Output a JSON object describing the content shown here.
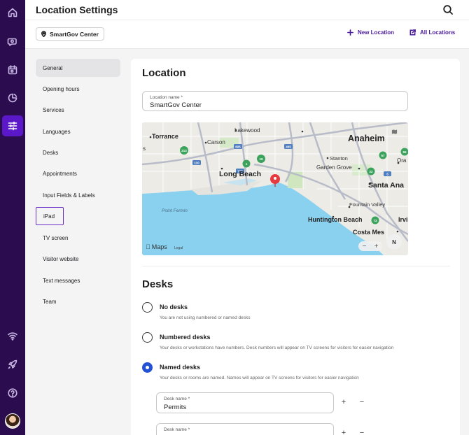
{
  "app": {
    "title": "Location Settings"
  },
  "rail": {
    "icons": [
      "home-icon",
      "search-chat-icon",
      "calendar-icon",
      "pie-chart-icon",
      "sliders-icon",
      "wifi-icon",
      "rocket-icon",
      "help-icon"
    ],
    "active": "sliders-icon",
    "accent": "#5b18c9",
    "background": "#2b0c4f"
  },
  "subbar": {
    "location_chip": "SmartGov Center",
    "new_location": "New Location",
    "all_locations": "All Locations"
  },
  "nav": {
    "items": [
      {
        "label": "General"
      },
      {
        "label": "Opening hours"
      },
      {
        "label": "Services"
      },
      {
        "label": "Languages"
      },
      {
        "label": "Desks"
      },
      {
        "label": "Appointments"
      },
      {
        "label": "Input Fields & Labels"
      },
      {
        "label": "iPad"
      },
      {
        "label": "TV screen"
      },
      {
        "label": "Visitor website"
      },
      {
        "label": "Text messages"
      },
      {
        "label": "Team"
      }
    ],
    "active": "General",
    "focused": "iPad"
  },
  "location": {
    "heading": "Location",
    "name_label": "Location name *",
    "name_value": "SmartGov Center"
  },
  "map": {
    "labels": {
      "torrance": "Torrance",
      "lakewood": "Lakewood",
      "anaheim": "Anaheim",
      "carson": "Carson",
      "stanton": "Stanton",
      "garden_grove": "Garden Grove",
      "long_beach": "Long Beach",
      "santa_ana": "Santa Ana",
      "fountain_valley": "Fountain Valley",
      "point_fermin": "Point Fermin",
      "huntington_beach": "Huntington Beach",
      "costa_mesa": "Costa Mes",
      "irvine": "Irvi",
      "orange": "Ora",
      "s_edge": "s"
    },
    "highways": [
      "605",
      "405",
      "110",
      "710",
      "213",
      "19",
      "1",
      "22",
      "57",
      "55",
      "73",
      "5"
    ],
    "logo": "Maps",
    "legal": "Legal",
    "compass": "N"
  },
  "desks": {
    "heading": "Desks",
    "options": [
      {
        "title": "No desks",
        "description": "You are not using numbered or named desks",
        "checked": false
      },
      {
        "title": "Numbered desks",
        "description": "Your desks or workstations have numbers. Desk numbers will appear on TV screens for visitors for easier navigation",
        "checked": false
      },
      {
        "title": "Named desks",
        "description": "Your desks or rooms are named. Names will appear on TV screens for visitors for easier navigation",
        "checked": true
      }
    ],
    "desk_fields": [
      {
        "label": "Desk name *",
        "value": "Permits"
      },
      {
        "label": "Desk name *",
        "value": ""
      }
    ],
    "add_symbol": "+",
    "remove_symbol": "−"
  }
}
